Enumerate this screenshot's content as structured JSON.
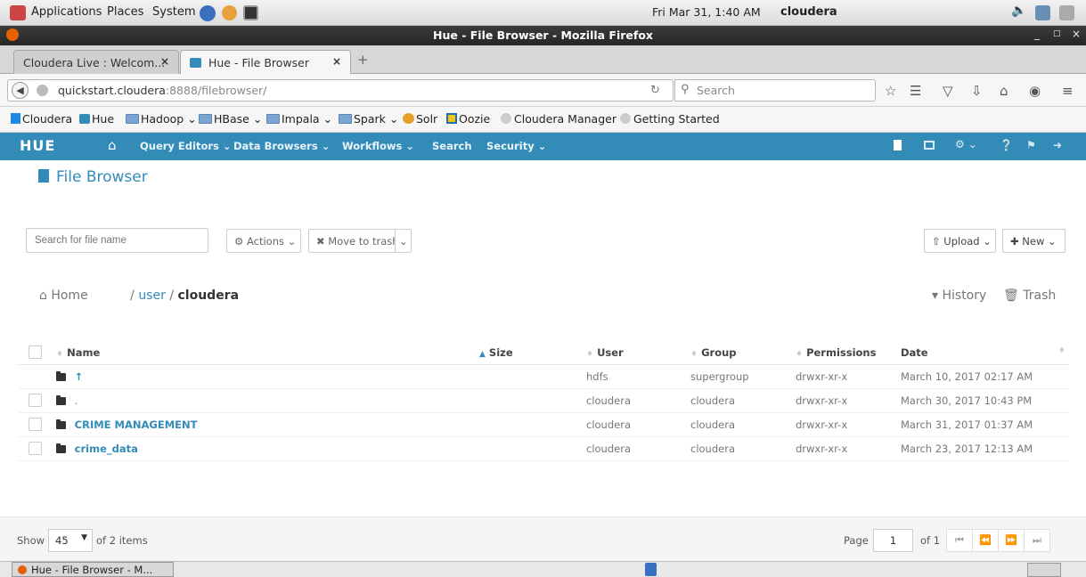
{
  "topbar": {
    "applications": "Applications",
    "places": "Places",
    "system": "System",
    "clock": "Fri Mar 31,  1:40 AM",
    "user": "cloudera"
  },
  "window": {
    "title": "Hue - File Browser - Mozilla Firefox"
  },
  "tabs": [
    {
      "label": "Cloudera Live : Welcom..."
    },
    {
      "label": "Hue - File Browser"
    }
  ],
  "navbar": {
    "url_host": "quickstart.cloudera",
    "url_path": ":8888/filebrowser/",
    "search_placeholder": "Search"
  },
  "bookmarks": [
    {
      "label": "Cloudera"
    },
    {
      "label": "Hue"
    },
    {
      "label": "Hadoop"
    },
    {
      "label": "HBase"
    },
    {
      "label": "Impala"
    },
    {
      "label": "Spark"
    },
    {
      "label": "Solr"
    },
    {
      "label": "Oozie"
    },
    {
      "label": "Cloudera Manager"
    },
    {
      "label": "Getting Started"
    }
  ],
  "hue_nav": {
    "logo": "HUE",
    "items": [
      "Query Editors",
      "Data Browsers",
      "Workflows",
      "Search",
      "Security"
    ]
  },
  "page": {
    "title": "File Browser",
    "search_placeholder": "Search for file name",
    "actions": "Actions",
    "move_to_trash": "Move to trash",
    "upload": "Upload",
    "new": "New",
    "breadcrumb_home": "Home",
    "breadcrumb_sep1": "/",
    "breadcrumb_user": "user",
    "breadcrumb_sep2": "/",
    "breadcrumb_current": "cloudera",
    "history": "History",
    "trash": "Trash"
  },
  "table": {
    "headers": [
      "Name",
      "Size",
      "User",
      "Group",
      "Permissions",
      "Date"
    ],
    "rows": [
      {
        "name": "↑",
        "size": "",
        "user": "hdfs",
        "group": "supergroup",
        "permissions": "drwxr-xr-x",
        "date": "March 10, 2017 02:17 AM"
      },
      {
        "name": ".",
        "size": "",
        "user": "cloudera",
        "group": "cloudera",
        "permissions": "drwxr-xr-x",
        "date": "March 30, 2017 10:43 PM"
      },
      {
        "name": "CRIME MANAGEMENT",
        "size": "",
        "user": "cloudera",
        "group": "cloudera",
        "permissions": "drwxr-xr-x",
        "date": "March 31, 2017 01:37 AM"
      },
      {
        "name": "crime_data",
        "size": "",
        "user": "cloudera",
        "group": "cloudera",
        "permissions": "drwxr-xr-x",
        "date": "March 23, 2017 12:13 AM"
      }
    ]
  },
  "footer": {
    "show": "Show",
    "page_size": "45",
    "of_items": "of 2 items",
    "page_label": "Page",
    "page_number": "1",
    "of_pages": "of 1"
  },
  "taskbar": {
    "window": "Hue - File Browser - M..."
  },
  "colors": {
    "hue_blue": "#338bb8",
    "link": "#338bb8"
  }
}
